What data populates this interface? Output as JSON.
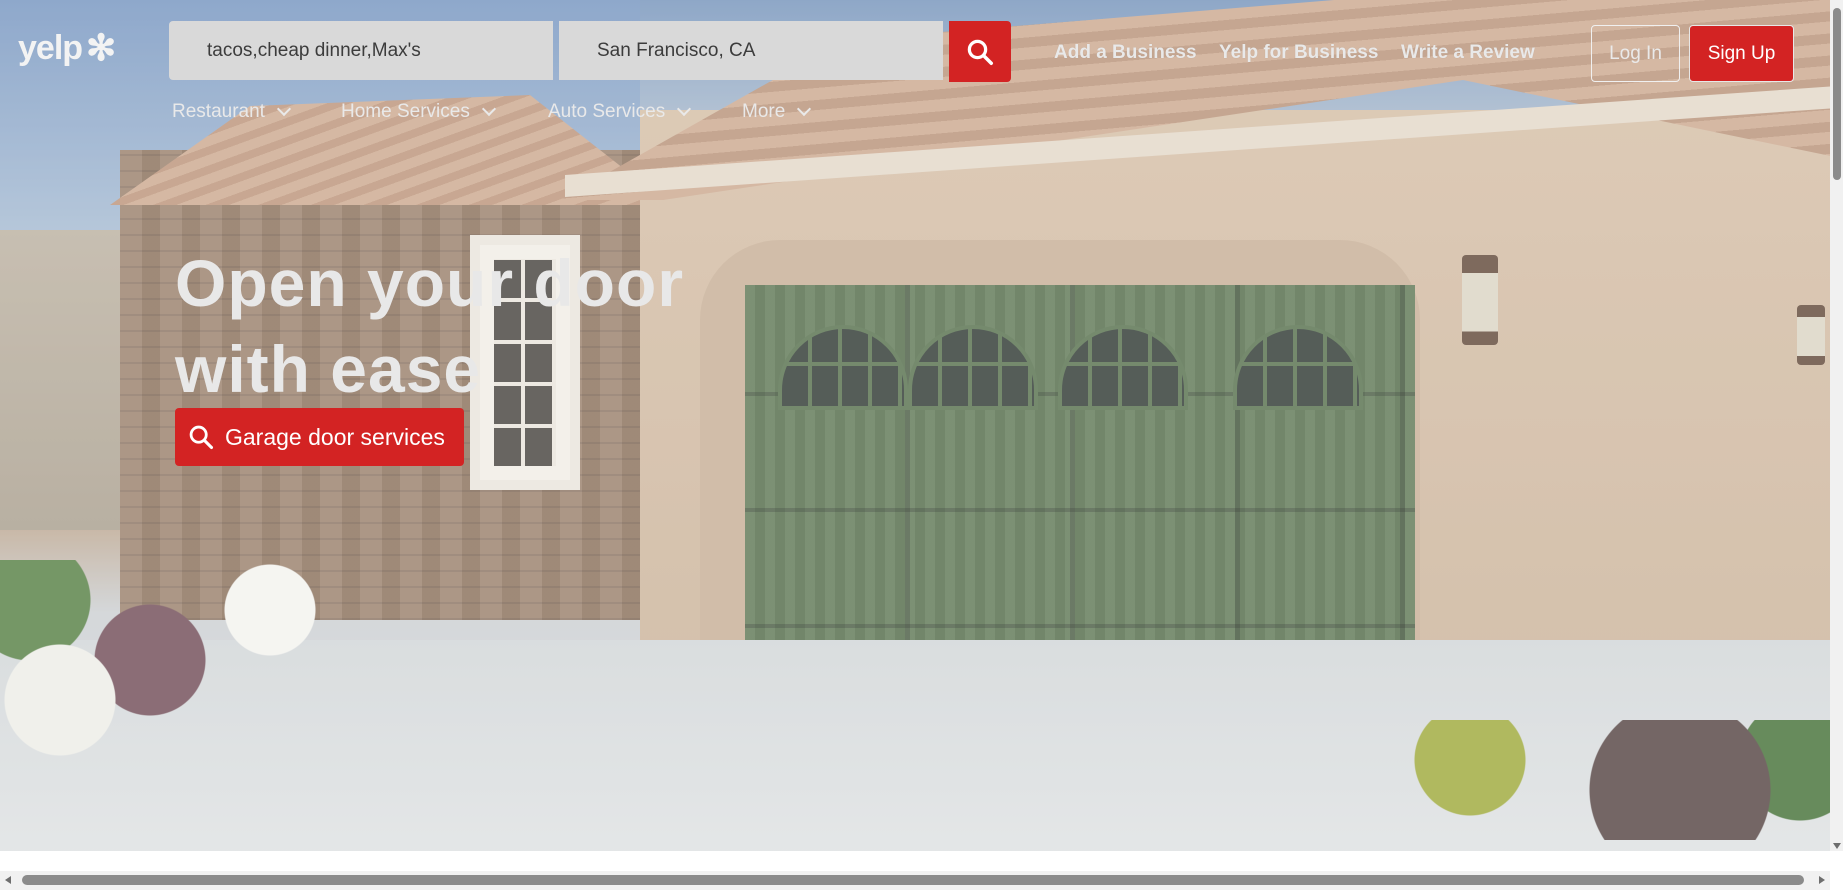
{
  "header": {
    "logo_text": "yelp",
    "find_value": "tacos,cheap dinner,Max's",
    "near_value": "San Francisco, CA",
    "search_button_icon": "search-icon",
    "links": {
      "add_business": "Add a Business",
      "yelp_for_business": "Yelp for Business",
      "write_review": "Write a Review"
    },
    "login_label": "Log In",
    "signup_label": "Sign Up"
  },
  "nav": {
    "items": [
      {
        "label": "Restaurant"
      },
      {
        "label": "Home Services"
      },
      {
        "label": "Auto Services"
      },
      {
        "label": "More"
      }
    ]
  },
  "hero": {
    "headline_line1": "Open your door",
    "headline_line2": "with ease",
    "cta_label": "Garage door services"
  },
  "colors": {
    "brand_red": "#d32323",
    "header_text": "#e9e9e9"
  }
}
